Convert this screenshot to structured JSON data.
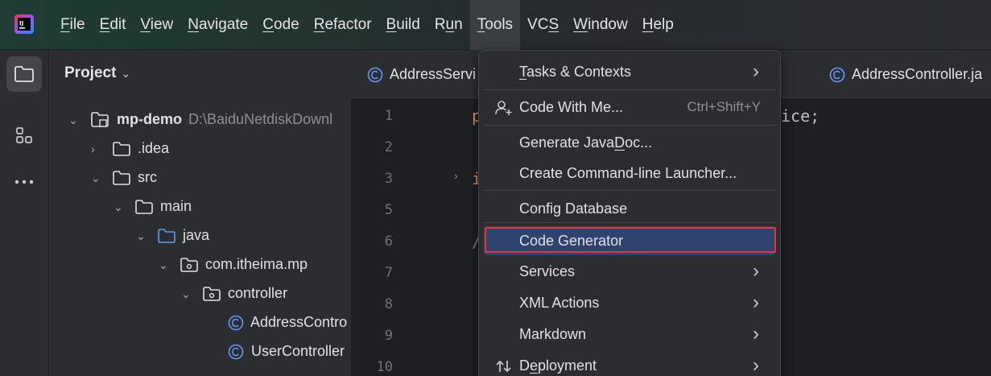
{
  "menubar": {
    "items": [
      {
        "pre": "",
        "mn": "F",
        "post": "ile"
      },
      {
        "pre": "",
        "mn": "E",
        "post": "dit"
      },
      {
        "pre": "",
        "mn": "V",
        "post": "iew"
      },
      {
        "pre": "",
        "mn": "N",
        "post": "avigate"
      },
      {
        "pre": "",
        "mn": "C",
        "post": "ode"
      },
      {
        "pre": "",
        "mn": "R",
        "post": "efactor"
      },
      {
        "pre": "",
        "mn": "B",
        "post": "uild"
      },
      {
        "pre": "R",
        "mn": "u",
        "post": "n"
      },
      {
        "pre": "",
        "mn": "T",
        "post": "ools"
      },
      {
        "pre": "VC",
        "mn": "S",
        "post": ""
      },
      {
        "pre": "",
        "mn": "W",
        "post": "indow"
      },
      {
        "pre": "",
        "mn": "H",
        "post": "elp"
      }
    ],
    "active_index": 8
  },
  "project_panel": {
    "title": "Project",
    "tree": [
      {
        "label": "mp-demo",
        "path": "D:\\BaiduNetdiskDownl",
        "bold": true
      },
      {
        "label": ".idea"
      },
      {
        "label": "src"
      },
      {
        "label": "main"
      },
      {
        "label": "java"
      },
      {
        "label": "com.itheima.mp"
      },
      {
        "label": "controller"
      },
      {
        "label": "AddressContro"
      },
      {
        "label": "UserController"
      }
    ]
  },
  "editor": {
    "tabs": [
      {
        "label": "AddressServi"
      },
      {
        "label": "AddressController.ja"
      }
    ],
    "line_numbers": [
      "1",
      "2",
      "3",
      "5",
      "6",
      "7",
      "8",
      "9",
      "10"
    ],
    "code_fragments": {
      "line1_left": "p",
      "line1_right": "ice;",
      "line3_left": "i",
      "line6_left": "/"
    }
  },
  "tools_menu": {
    "items": [
      {
        "pre": "",
        "mn": "T",
        "post": "asks & Contexts",
        "submenu": true
      },
      {
        "pre": "Code With Me...",
        "mn": "",
        "post": "",
        "shortcut": "Ctrl+Shift+Y",
        "icon": "person-add-icon"
      },
      {
        "pre": "Generate Java",
        "mn": "D",
        "post": "oc..."
      },
      {
        "pre": "Create Command-line Launcher...",
        "mn": "",
        "post": ""
      },
      {
        "pre": "Config Database",
        "mn": "",
        "post": ""
      },
      {
        "pre": "Code Generator",
        "mn": "",
        "post": "",
        "highlighted": true
      },
      {
        "pre": "Services",
        "mn": "",
        "post": "",
        "submenu": true
      },
      {
        "pre": "XML Actions",
        "mn": "",
        "post": "",
        "submenu": true
      },
      {
        "pre": "Markdown",
        "mn": "",
        "post": "",
        "submenu": true
      },
      {
        "pre": "D",
        "mn": "e",
        "post": "ployment",
        "submenu": true,
        "icon": "deployment-arrows-icon"
      }
    ]
  },
  "colors": {
    "highlight": "#2e436e",
    "annotation_box": "#e5343a",
    "panel": "#2b2d30",
    "editor_bg": "#1e1f22"
  }
}
